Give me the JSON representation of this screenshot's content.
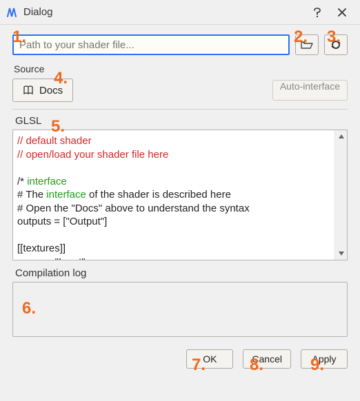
{
  "window": {
    "title": "Dialog"
  },
  "path": {
    "value": "",
    "placeholder": "Path to your shader file..."
  },
  "labels": {
    "source": "Source",
    "glsl": "GLSL",
    "compilation_log": "Compilation log"
  },
  "buttons": {
    "docs": "Docs",
    "auto_interface": "Auto-interface",
    "ok": "OK",
    "cancel": "Cancel",
    "apply": "Apply"
  },
  "code": {
    "l1": "// default shader",
    "l2": "// open/load your shader file here",
    "l3": "",
    "l4a": "/* ",
    "l4b": "interface",
    "l5a": "# The ",
    "l5b": "interface",
    "l5c": " of the shader is described here",
    "l6": "# Open the \"Docs\" above to understand the syntax",
    "l7": "outputs = [\"Output\"]",
    "l8": "",
    "l9": "[[textures]]",
    "l10": "name = \"Input\""
  },
  "compilation_log": "",
  "annotations": {
    "n1": "1.",
    "n2": "2.",
    "n3": "3.",
    "n4": "4.",
    "n5": "5.",
    "n6": "6.",
    "n7": "7.",
    "n8": "8.",
    "n9": "9."
  }
}
